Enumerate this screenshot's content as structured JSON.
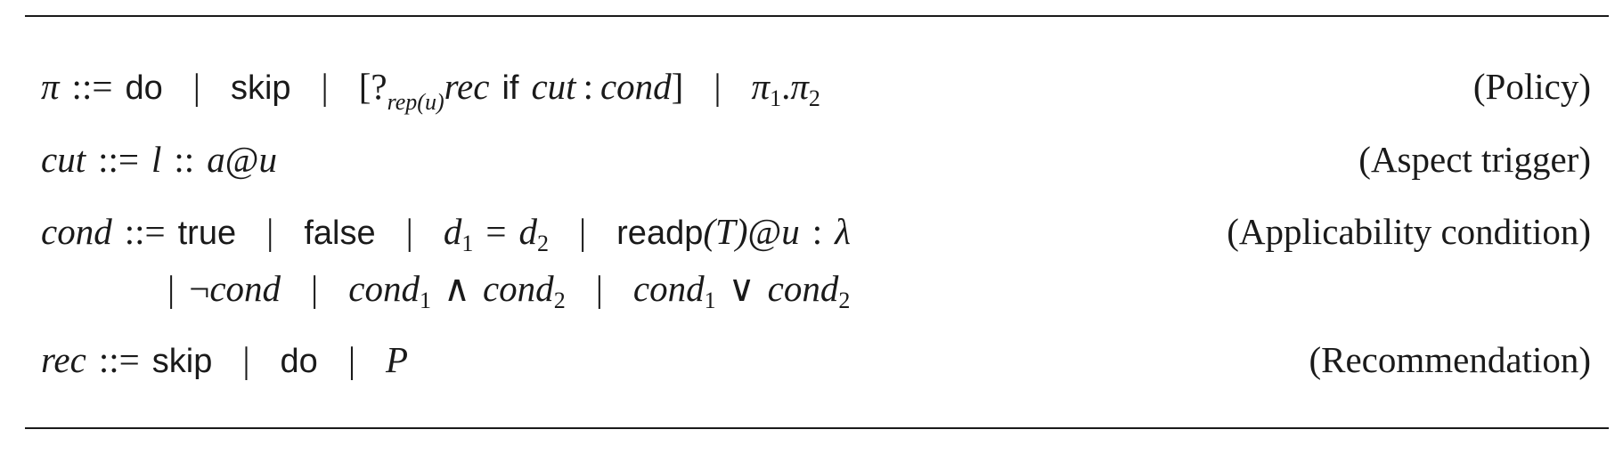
{
  "grammar": {
    "policy": {
      "lhs": "π",
      "def": "::=",
      "alt_do": "do",
      "alt_skip": "skip",
      "bracket_open": "[?",
      "rep_sub": "rep(u)",
      "rec": "rec",
      "kw_if": "if",
      "cut": "cut",
      "colon": ":",
      "cond": "cond",
      "bracket_close": "]",
      "seq_left": "π",
      "seq_left_sub": "1",
      "dot": ".",
      "seq_right": "π",
      "seq_right_sub": "2",
      "label": "(Policy)"
    },
    "cut": {
      "lhs": "cut",
      "def": "::=",
      "l": "l",
      "dcolon": "::",
      "a": "a",
      "at": "@",
      "u": "u",
      "label": "(Aspect trigger)"
    },
    "cond": {
      "lhs": "cond",
      "def": "::=",
      "true": "true",
      "false": "false",
      "d1": "d",
      "d1_sub": "1",
      "eq": "=",
      "d2": "d",
      "d2_sub": "2",
      "readp": "readp",
      "readp_arg": "(T)",
      "at": "@",
      "u": "u",
      "colon": ":",
      "lambda": "λ",
      "label": "(Applicability condition)",
      "neg": "¬",
      "neg_cond": "cond",
      "and_left": "cond",
      "and_left_sub": "1",
      "and": "∧",
      "and_right": "cond",
      "and_right_sub": "2",
      "or_left": "cond",
      "or_left_sub": "1",
      "or": "∨",
      "or_right": "cond",
      "or_right_sub": "2"
    },
    "rec": {
      "lhs": "rec",
      "def": "::=",
      "skip": "skip",
      "do": "do",
      "p": "P",
      "label": "(Recommendation)"
    },
    "bar": "|"
  }
}
